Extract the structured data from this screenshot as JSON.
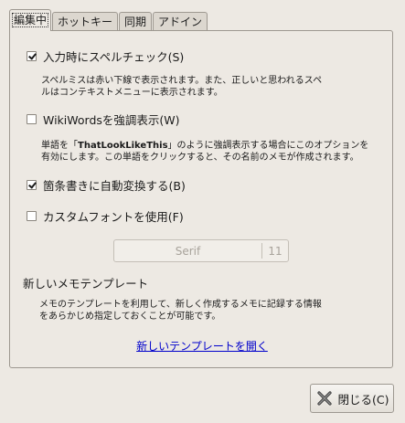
{
  "tabs": [
    {
      "label": "編集中",
      "active": true
    },
    {
      "label": "ホットキー",
      "active": false
    },
    {
      "label": "同期",
      "active": false
    },
    {
      "label": "アドイン",
      "active": false
    }
  ],
  "options": {
    "spellcheck": {
      "label": "入力時にスペルチェック(S)",
      "checked": true,
      "desc_line1": "スペルミスは赤い下線で表示されます。また、正しいと思われるスペ",
      "desc_line2": "ルはコンテキストメニューに表示されます。"
    },
    "wikiwords": {
      "label": "WikiWordsを強調表示(W)",
      "checked": false,
      "desc_prefix": "単語を「",
      "desc_example": "ThatLookLikeThis",
      "desc_suffix": "」のように強調表示する場合にこのオプションを",
      "desc_line2": "有効にします。この単語をクリックすると、その名前のメモが作成されます。"
    },
    "autobullet": {
      "label": "箇条書きに自動変換する(B)",
      "checked": true
    },
    "customfont": {
      "label": "カスタムフォントを使用(F)",
      "checked": false
    }
  },
  "font_button": {
    "name": "Serif",
    "size": "11"
  },
  "template": {
    "title": "新しいメモテンプレート",
    "desc_line1": "メモのテンプレートを利用して、新しく作成するメモに記録する情報",
    "desc_line2": "をあらかじめ指定しておくことが可能です。",
    "link": "新しいテンプレートを開く"
  },
  "close_button": {
    "label": "閉じる(C)"
  }
}
